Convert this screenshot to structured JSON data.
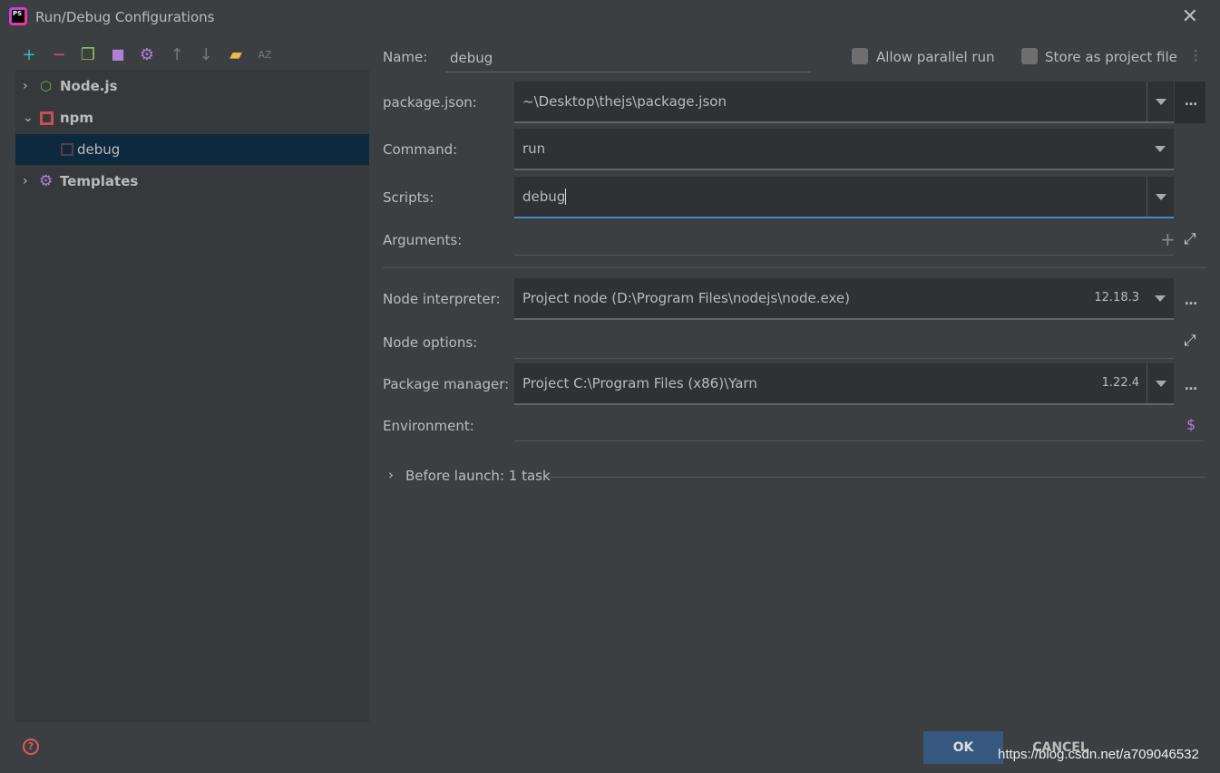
{
  "window": {
    "title": "Run/Debug Configurations",
    "logo": "PS"
  },
  "toolbar": [
    "add-icon",
    "remove-icon",
    "copy-icon",
    "save-icon",
    "settings-icon",
    "move-up-icon",
    "move-down-icon",
    "new-folder-icon",
    "sort-az-icon"
  ],
  "tree": [
    {
      "label": "Node.js",
      "icon": "nodejs-icon",
      "expanded": false
    },
    {
      "label": "npm",
      "icon": "npm-icon",
      "expanded": true
    },
    {
      "label": "debug",
      "icon": "npm-icon",
      "selected": true
    },
    {
      "label": "Templates",
      "icon": "gear-icon",
      "expanded": false
    }
  ],
  "form": {
    "name_label": "Name:",
    "name_value": "debug",
    "allow_parallel": "Allow parallel run",
    "store_project": "Store as project file",
    "package_label": "package.json:",
    "package_value": "~\\Desktop\\thejs\\package.json",
    "command_label": "Command:",
    "command_value": "run",
    "scripts_label": "Scripts:",
    "scripts_value": "debug",
    "arguments_label": "Arguments:",
    "interpreter_label": "Node interpreter:",
    "interpreter_value": "Project  node (D:\\Program Files\\nodejs\\node.exe)",
    "interpreter_version": "12.18.3",
    "options_label": "Node options:",
    "pm_label": "Package manager:",
    "pm_value": "Project   C:\\Program Files (x86)\\Yarn",
    "pm_version": "1.22.4",
    "env_label": "Environment:",
    "before_launch": "Before launch: 1 task"
  },
  "buttons": {
    "ok": "OK",
    "cancel": "CANCEL"
  },
  "watermark": "https://blog.csdn.net/a709046532",
  "colors": {
    "accent": "#365880",
    "selection": "#0d293e",
    "focus": "#4a88c7"
  }
}
